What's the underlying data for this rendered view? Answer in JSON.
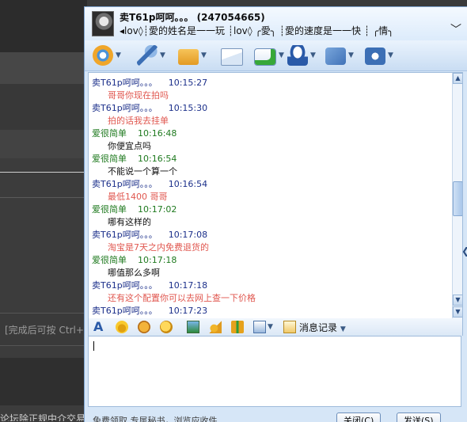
{
  "background_app": {
    "hint_text": "[完成后可按  Ctrl+E",
    "bottom_text": "论坛除正规中介交易"
  },
  "contact": {
    "name": "卖T61p呵呵。。。 (247054665)",
    "signature": "◂lov◊┊愛的姓名是一一玩   ┊lov◊   ╭愛╮   ┊愛的速度是一一快   ┊   ╭情╮"
  },
  "toolbar": {
    "icons": [
      "video-call-icon",
      "voice-call-icon",
      "send-file-icon",
      "send-email-icon",
      "add-app-icon",
      "qq-show-icon",
      "game-icon",
      "settings-icon"
    ]
  },
  "messages": [
    {
      "sender": "卖T61p呵呵。。。",
      "time": "10:15:27",
      "text": "哥哥你现在拍吗",
      "role": "seller"
    },
    {
      "sender": "卖T61p呵呵。。。",
      "time": "10:15:30",
      "text": "拍的话我去挂单",
      "role": "seller"
    },
    {
      "sender": "爱很简单",
      "time": "10:16:48",
      "text": "你便宜点吗",
      "role": "buyer"
    },
    {
      "sender": "爱很简单",
      "time": "10:16:54",
      "text": "不能说一个算一个",
      "role": "buyer"
    },
    {
      "sender": "卖T61p呵呵。。。",
      "time": "10:16:54",
      "text": "最低1400  哥哥",
      "role": "seller"
    },
    {
      "sender": "爱很简单",
      "time": "10:17:02",
      "text": "哪有这样的",
      "role": "buyer"
    },
    {
      "sender": "卖T61p呵呵。。。",
      "time": "10:17:08",
      "text": "淘宝是7天之内免费退货的",
      "role": "seller"
    },
    {
      "sender": "爱很简单",
      "time": "10:17:18",
      "text": "哪值那么多啊",
      "role": "buyer"
    },
    {
      "sender": "卖T61p呵呵。。。",
      "time": "10:17:18",
      "text": "还有这个配置你可以去网上查一下价格",
      "role": "seller"
    },
    {
      "sender": "卖T61p呵呵。。。",
      "time": "10:17:23",
      "text": "",
      "role": "seller"
    }
  ],
  "format_bar": {
    "records_label": "消息记录"
  },
  "input": {
    "value": ""
  },
  "status": {
    "text": "免费领取   专属秘书，浏览应收件...",
    "close_label": "关闭(C)",
    "send_label": "发送(S)"
  },
  "colors": {
    "seller_sender": "#1b2f8a",
    "buyer_sender": "#1f7a1f",
    "seller_text": "#e0574f",
    "buyer_text": "#101010"
  }
}
